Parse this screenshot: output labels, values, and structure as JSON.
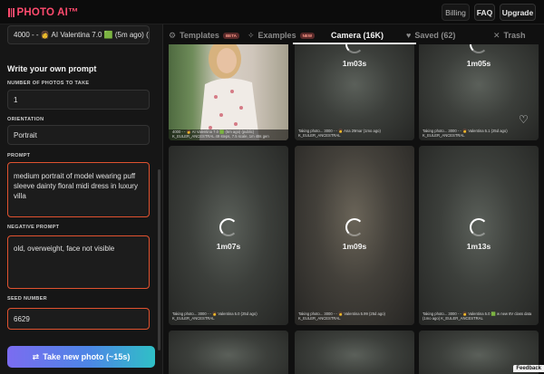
{
  "app": {
    "logo_text": "PHOTO AI™",
    "nav": {
      "billing": "Billing",
      "faq": "FAQ",
      "upgrade": "Upgrade"
    }
  },
  "sidebar": {
    "model_select": "4000 - - 👩 AI Valentina 7.0 🟩 (5m ago) (pu",
    "section_title": "Write your own prompt",
    "fields": {
      "num_photos": {
        "label": "NUMBER OF PHOTOS TO TAKE",
        "value": "1"
      },
      "orientation": {
        "label": "ORIENTATION",
        "value": "Portrait"
      },
      "prompt": {
        "label": "PROMPT",
        "value": "medium portrait of model wearing puff sleeve dainty floral midi dress in luxury villa"
      },
      "negative_prompt": {
        "label": "NEGATIVE PROMPT",
        "value": "old, overweight, face not visible"
      },
      "seed": {
        "label": "SEED NUMBER",
        "value": "6629"
      }
    },
    "cta": {
      "icon": "arrows-swap-icon",
      "label": "Take new photo (~15s)"
    }
  },
  "tabs": [
    {
      "label": "Templates",
      "icon": "gear-icon",
      "badge": "BETA",
      "active": false
    },
    {
      "label": "Examples",
      "icon": "sparkle-icon",
      "badge": "NEW",
      "active": false
    },
    {
      "label": "Camera (16K)",
      "icon": "",
      "badge": "",
      "active": true
    },
    {
      "label": "Saved (62)",
      "icon": "heart-icon",
      "badge": "",
      "active": false
    },
    {
      "label": "Trash",
      "icon": "close-icon",
      "badge": "",
      "active": false
    }
  ],
  "grid": {
    "row1": [
      {
        "caption_1": "4000 - - 👩 AI Valentina 7.0 🟩 (5m ago) (public)",
        "caption_2": "K_EULER_ANCESTRAL 49 steps, 7.5 scale, 1m 48s gen"
      },
      {
        "time": "1m03s",
        "caption_1": "Taking photo... 3000 - - 👩 Ana 29mar (1mo ago)",
        "caption_2": "K_EULER_ANCESTRAL"
      },
      {
        "time": "1m05s",
        "caption_1": "Taking photo... 3000 - - 👩 Valentina 5.1 (25d ago)",
        "caption_2": "K_EULER_ANCESTRAL"
      }
    ],
    "row2": [
      {
        "time": "1m07s",
        "caption_1": "Taking photo... 3000 - - 👩 Valentina 5.0 (25d ago)",
        "caption_2": "K_EULER_ANCESTRAL"
      },
      {
        "time": "1m09s",
        "caption_1": "Taking photo... 3000 - - 👩 Valentina 5.99 (25d ago)",
        "caption_2": "K_EULER_ANCESTRAL"
      },
      {
        "time": "1m13s",
        "caption_1": "Taking photo... 3000 - - 👩 Valentina 5.0 🟩 w new 8V class data",
        "caption_2": "(1mo ago) K_EULER_ANCESTRAL"
      }
    ]
  },
  "feedback": "Feedback"
}
